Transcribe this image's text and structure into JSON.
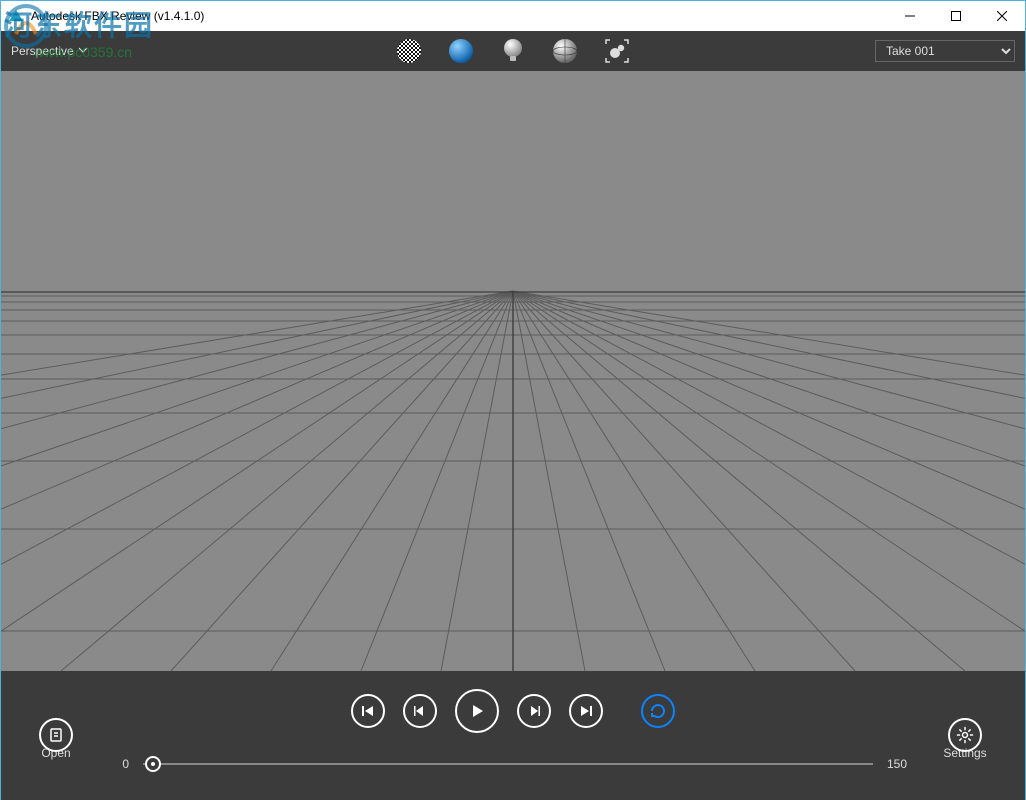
{
  "window": {
    "title": "Autodesk FBX Review (v1.4.1.0)"
  },
  "watermark": {
    "text": "河东软件园",
    "url": "www.pc0359.cn"
  },
  "toolbar": {
    "view_mode": "Perspective",
    "take_selected": "Take 001",
    "icons": {
      "wireframe": "wireframe-sphere-icon",
      "shaded": "shaded-sphere-icon",
      "lit": "light-bulb-icon",
      "xray": "xray-sphere-icon",
      "frame": "frame-selection-icon"
    }
  },
  "timeline": {
    "start": "0",
    "end": "150"
  },
  "buttons": {
    "open_label": "Open",
    "settings_label": "Settings"
  },
  "colors": {
    "accent": "#0a84ff",
    "viewport_bg": "#8a8a8a"
  }
}
